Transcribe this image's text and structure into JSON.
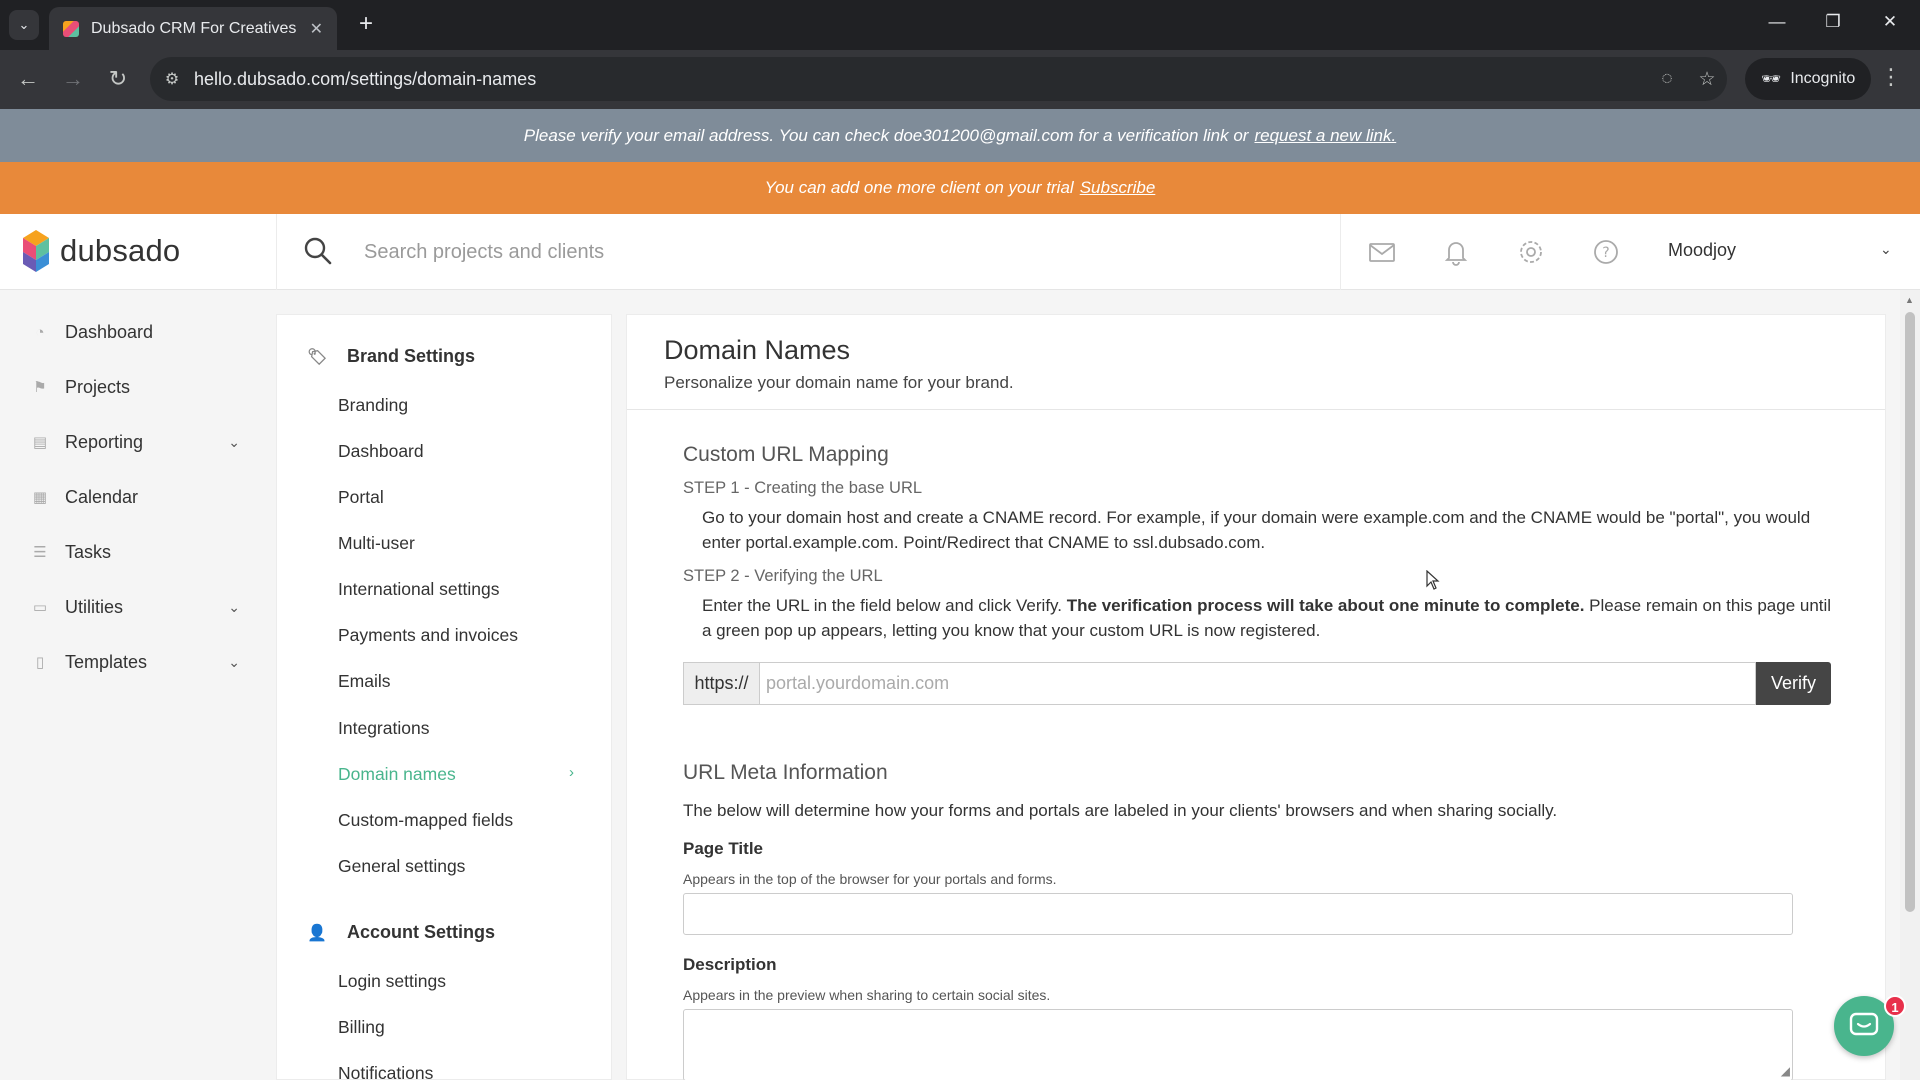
{
  "browser": {
    "tab_title": "Dubsado CRM For Creatives",
    "url": "hello.dubsado.com/settings/domain-names",
    "incognito_label": "Incognito",
    "tab_menu_icon": "chevron-down-icon",
    "close_icon": "close-icon",
    "new_tab_icon": "plus-icon"
  },
  "banners": {
    "verify_text": "Please verify your email address. You can check doe301200@gmail.com for a verification link or",
    "verify_link": "request a new link.",
    "trial_text": "You can add one more client on your trial",
    "trial_link": "Subscribe",
    "verify_color": "#7f8c99",
    "trial_color": "#e8893a"
  },
  "header": {
    "logo_text": "dubsado",
    "search_placeholder": "Search projects and clients",
    "user_name": "Moodjoy"
  },
  "sidebar": {
    "items": [
      {
        "label": "Dashboard",
        "icon": "dashboard-icon"
      },
      {
        "label": "Projects",
        "icon": "projects-icon"
      },
      {
        "label": "Reporting",
        "icon": "reporting-icon",
        "expandable": true
      },
      {
        "label": "Calendar",
        "icon": "calendar-icon"
      },
      {
        "label": "Tasks",
        "icon": "tasks-icon"
      },
      {
        "label": "Utilities",
        "icon": "utilities-icon",
        "expandable": true
      },
      {
        "label": "Templates",
        "icon": "templates-icon",
        "expandable": true
      }
    ]
  },
  "settings_nav": {
    "brand_heading": "Brand Settings",
    "brand_items": [
      "Branding",
      "Dashboard",
      "Portal",
      "Multi-user",
      "International settings",
      "Payments and invoices",
      "Emails",
      "Integrations",
      "Domain names",
      "Custom-mapped fields",
      "General settings"
    ],
    "active_item": "Domain names",
    "account_heading": "Account Settings",
    "account_items": [
      "Login settings",
      "Billing",
      "Notifications"
    ]
  },
  "main": {
    "title": "Domain Names",
    "subtitle": "Personalize your domain name for your brand.",
    "custom_url": {
      "heading": "Custom URL Mapping",
      "step1_label": "STEP 1 - Creating the base URL",
      "step1_text": "Go to your domain host and create a CNAME record. For example, if your domain were example.com and the CNAME would be \"portal\", you would enter portal.example.com. Point/Redirect that CNAME to ssl.dubsado.com.",
      "step2_label": "STEP 2 - Verifying the URL",
      "step2_text_a": "Enter the URL in the field below and click Verify.",
      "step2_text_bold": "The verification process will take about one minute to complete.",
      "step2_text_b": "Please remain on this page until a green pop up appears, letting you know that your custom URL is now registered.",
      "prefix": "https://",
      "placeholder": "portal.yourdomain.com",
      "verify_label": "Verify"
    },
    "meta": {
      "heading": "URL Meta Information",
      "description": "The below will determine how your forms and portals are labeled in your clients' browsers and when sharing socially.",
      "page_title_label": "Page Title",
      "page_title_help": "Appears in the top of the browser for your portals and forms.",
      "page_title_value": "",
      "description_label": "Description",
      "description_help": "Appears in the preview when sharing to certain social sites.",
      "description_value": ""
    }
  },
  "chat": {
    "badge_count": "1",
    "accent": "#49b58d"
  },
  "colors": {
    "active_green": "#49b58d"
  }
}
